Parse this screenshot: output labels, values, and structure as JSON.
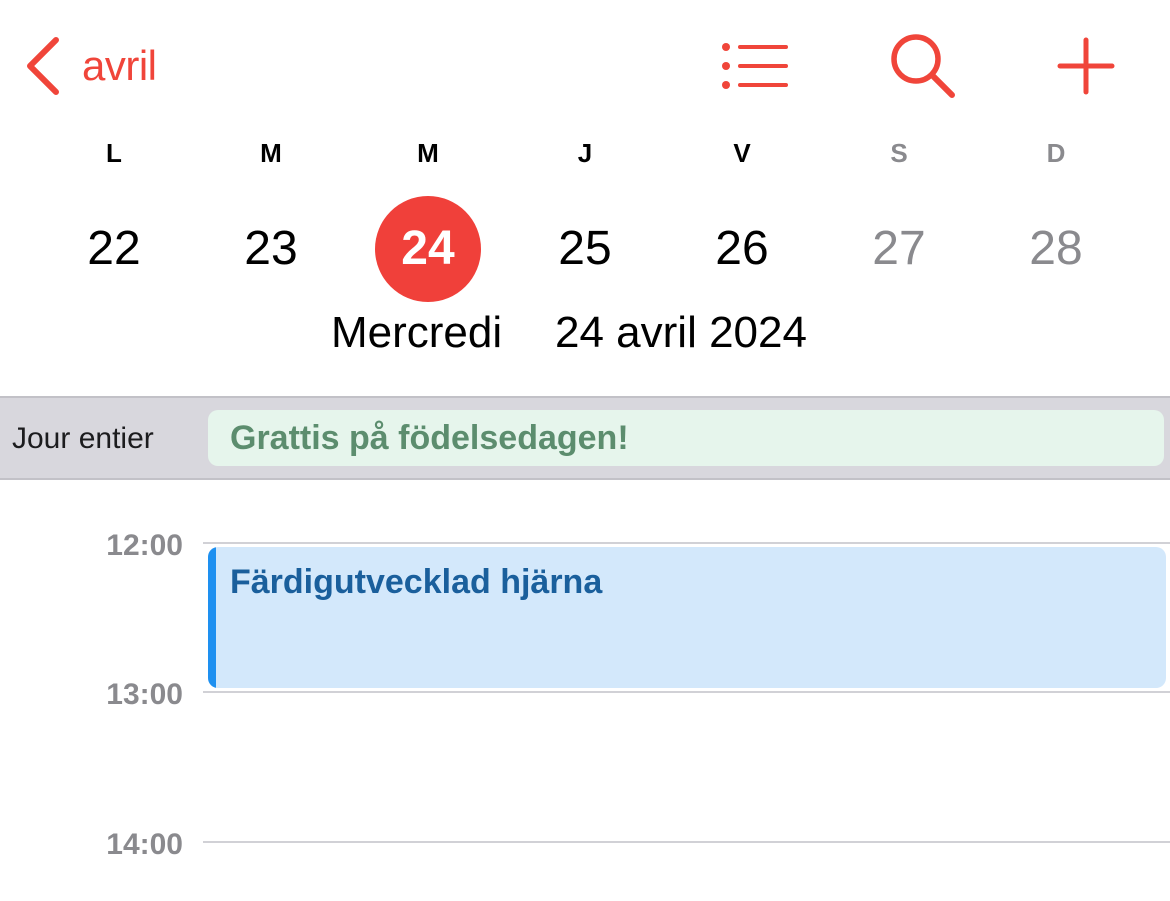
{
  "nav": {
    "back_label": "avril",
    "accent_color": "#f0453a",
    "icons": [
      "chevron-left-icon",
      "list-icon",
      "search-icon",
      "plus-icon"
    ]
  },
  "week": {
    "weekdays": [
      "L",
      "M",
      "M",
      "J",
      "V",
      "S",
      "D"
    ],
    "days": [
      "22",
      "23",
      "24",
      "25",
      "26",
      "27",
      "28"
    ],
    "selected_day": "24"
  },
  "selected_date": {
    "weekday": "Mercredi",
    "date": "24 avril 2024"
  },
  "allday": {
    "label": "Jour entier",
    "event_title": "Grattis på födelsedagen!"
  },
  "timeline": {
    "hours": [
      "12:00",
      "13:00",
      "14:00"
    ]
  },
  "event": {
    "title": "Färdigutvecklad hjärna",
    "start": "12:00",
    "end": "13:00",
    "color": "#1e90f0"
  }
}
